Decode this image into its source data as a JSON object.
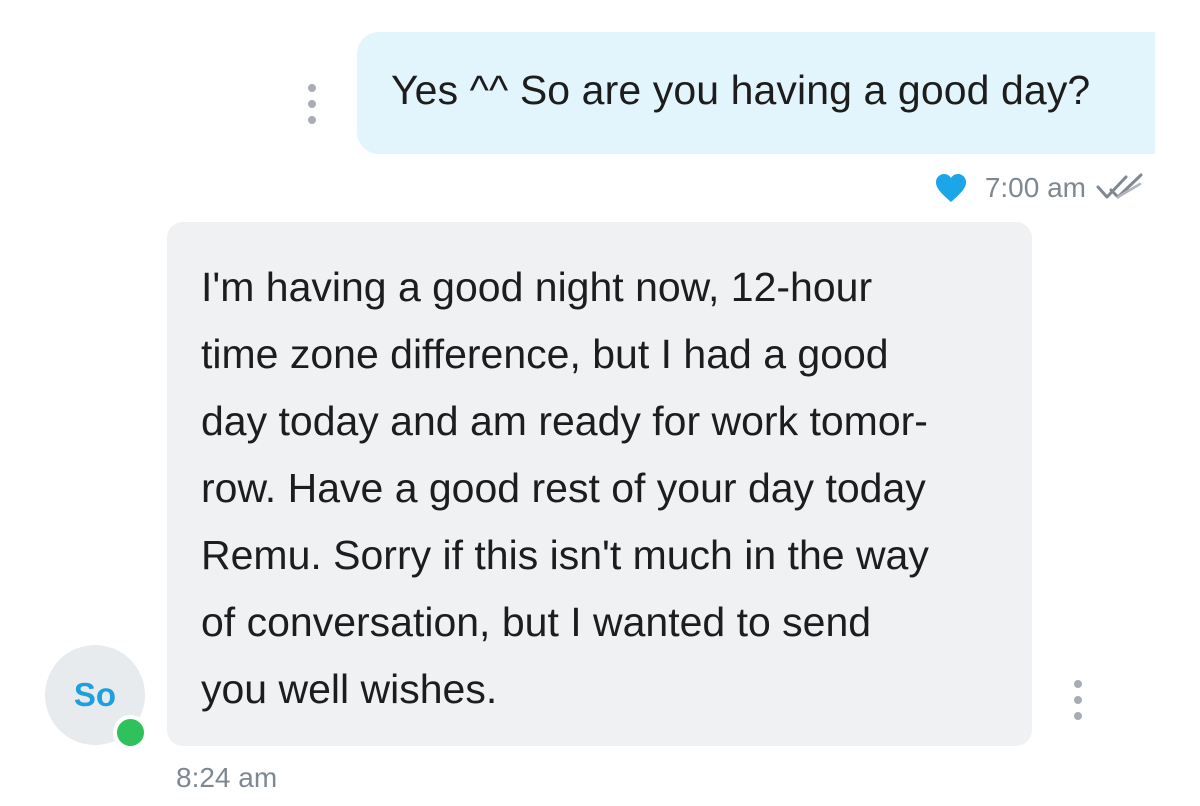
{
  "colors": {
    "outgoing_bubble": "#e2f4fc",
    "incoming_bubble": "#f0f1f3",
    "accent": "#1da0e0",
    "online": "#2fc15c",
    "meta_text": "#7f8891"
  },
  "icons": {
    "more": "more-vertical-icon",
    "reaction": "heart-icon",
    "read_receipt": "double-check-icon"
  },
  "outgoing": {
    "text": "Yes ^^ So are you having a good day?",
    "time": "7:00 am",
    "reaction": "heart",
    "status": "read"
  },
  "incoming": {
    "avatar_initials": "So",
    "online": true,
    "lines": [
      "I'm having a good night now, 12-hour",
      "time zone difference, but I had a good",
      "day today and am ready for work tomor-",
      "row. Have a good rest of your day today",
      "Remu. Sorry if this isn't much in the way",
      "of conversation, but I wanted to send",
      "you well wishes."
    ],
    "time": "8:24 am"
  }
}
